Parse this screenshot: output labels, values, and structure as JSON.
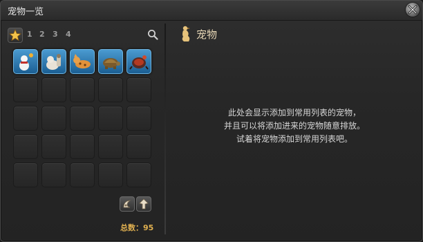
{
  "window": {
    "title": "宠物一览"
  },
  "sidebar": {
    "pages": [
      "1",
      "2",
      "3",
      "4"
    ],
    "slots": [
      {
        "filled": true,
        "icon": "snowman-minion-icon"
      },
      {
        "filled": true,
        "icon": "mole-minion-icon"
      },
      {
        "filled": true,
        "icon": "cat-minion-icon"
      },
      {
        "filled": true,
        "icon": "tortoise-minion-icon"
      },
      {
        "filled": true,
        "icon": "beetle-minion-icon"
      },
      {
        "filled": false
      },
      {
        "filled": false
      },
      {
        "filled": false
      },
      {
        "filled": false
      },
      {
        "filled": false
      },
      {
        "filled": false
      },
      {
        "filled": false
      },
      {
        "filled": false
      },
      {
        "filled": false
      },
      {
        "filled": false
      },
      {
        "filled": false
      },
      {
        "filled": false
      },
      {
        "filled": false
      },
      {
        "filled": false
      },
      {
        "filled": false
      },
      {
        "filled": false
      },
      {
        "filled": false
      },
      {
        "filled": false
      },
      {
        "filled": false
      },
      {
        "filled": false
      }
    ],
    "total": "总数：95"
  },
  "main": {
    "heading": "宠物",
    "message_lines": [
      "此处会显示添加到常用列表的宠物，",
      "并且可以将添加进来的宠物随意排放。",
      "试着将宠物添加到常用列表吧。"
    ]
  },
  "colors": {
    "accent_gold": "#e0b050",
    "slot_filled": "#2f7fbf",
    "heading_text": "#e7d7b6"
  }
}
